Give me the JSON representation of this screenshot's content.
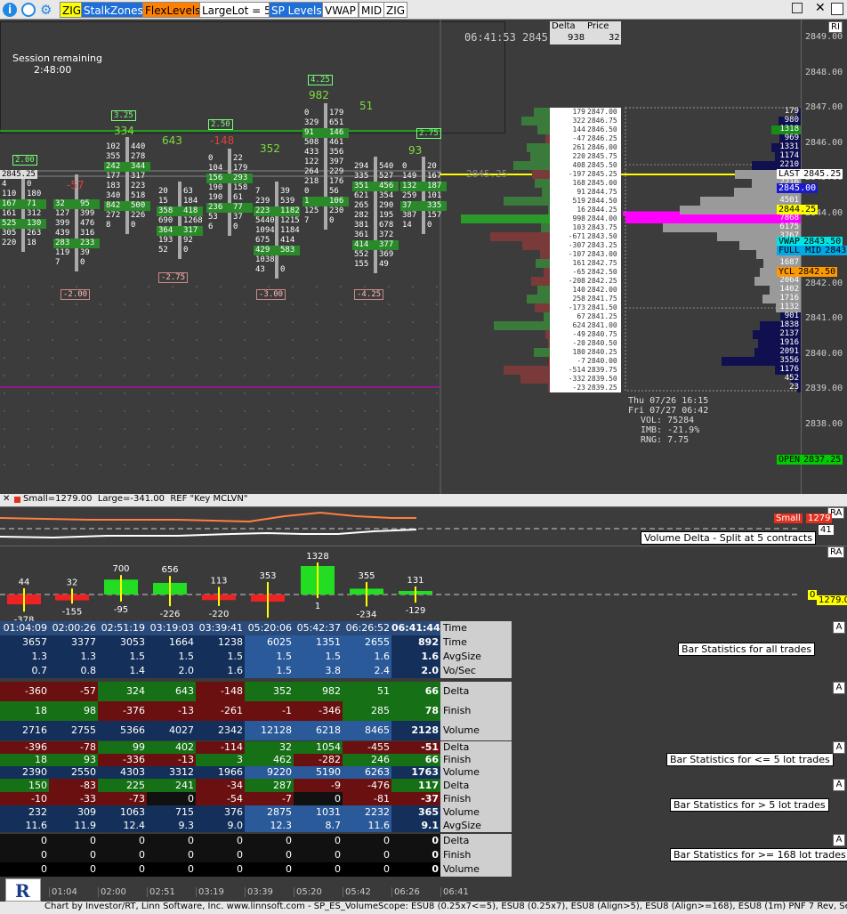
{
  "toolbar": {
    "buttons": [
      {
        "label": "ZIG",
        "bg": "#ffff00",
        "fg": "#000000"
      },
      {
        "label": "StalkZones",
        "bg": "#1e6fd9",
        "fg": "#ffffff"
      },
      {
        "label": "FlexLevels",
        "bg": "#ff7f00",
        "fg": "#000000"
      },
      {
        "label": "LargeLot = 5",
        "bg": "#ffffff",
        "fg": "#000000"
      },
      {
        "label": "SP Levels",
        "bg": "#1e6fd9",
        "fg": "#ffffff"
      },
      {
        "label": "VWAP",
        "bg": "#ffffff",
        "fg": "#000000"
      },
      {
        "label": "MID",
        "bg": "#ffffff",
        "fg": "#000000"
      },
      {
        "label": "ZIG",
        "bg": "#ffffff",
        "fg": "#000000"
      }
    ],
    "right_ri": "RI"
  },
  "session": {
    "label": "Session remaining",
    "time": "2:48:00"
  },
  "clock": {
    "time": "06:41:53",
    "price": "2845.25",
    "delta_header": "Delta",
    "price_header": "Price",
    "delta_value": "938",
    "price_value": "32"
  },
  "price_axis": {
    "ticks": [
      "2849.00",
      "2848.00",
      "2847.00",
      "2846.00",
      "2845.00",
      "2844.00",
      "2843.00",
      "2842.00",
      "2841.00",
      "2840.00",
      "2839.00",
      "2838.00",
      "2837.00"
    ],
    "labels": [
      {
        "text": "LAST",
        "value": "2845.25",
        "bg": "#ffffff",
        "fg": "#000000"
      },
      {
        "text": "",
        "value": "2845.00",
        "bg": "#1a1acc",
        "fg": "#ffffff"
      },
      {
        "text": "",
        "value": "2844.25",
        "bg": "#ffff00",
        "fg": "#000000"
      },
      {
        "text": "VWAP",
        "value": "2843.50",
        "bg": "#00e5e5",
        "fg": "#000000"
      },
      {
        "text": "FULL MID",
        "value": "2843.25",
        "bg": "#00a8e5",
        "fg": "#000000"
      },
      {
        "text": "YCL",
        "value": "2842.50",
        "bg": "#ff9900",
        "fg": "#000000"
      },
      {
        "text": "OPEN",
        "value": "2837.25",
        "bg": "#00cc00",
        "fg": "#000000"
      }
    ]
  },
  "ladder": {
    "rows": [
      {
        "d": "179",
        "p": "2847.00",
        "vol": "179"
      },
      {
        "d": "322",
        "p": "2846.75",
        "vol": "980"
      },
      {
        "d": "144",
        "p": "2846.50",
        "vol": "1318"
      },
      {
        "d": "-47",
        "p": "2846.25",
        "vol": "969"
      },
      {
        "d": "261",
        "p": "2846.00",
        "vol": "1331"
      },
      {
        "d": "220",
        "p": "2845.75",
        "vol": "1174"
      },
      {
        "d": "408",
        "p": "2845.50",
        "vol": "2210"
      },
      {
        "d": "-197",
        "p": "2845.25",
        "vol": "2975"
      },
      {
        "d": "168",
        "p": "2845.00",
        "vol": "2216"
      },
      {
        "d": "91",
        "p": "2844.75",
        "vol": "3003"
      },
      {
        "d": "519",
        "p": "2844.50",
        "vol": "4501"
      },
      {
        "d": "16",
        "p": "2844.25",
        "vol": "5440"
      },
      {
        "d": "998",
        "p": "2844.00",
        "vol": "7868"
      },
      {
        "d": "103",
        "p": "2843.75",
        "vol": "6175"
      },
      {
        "d": "-671",
        "p": "2843.50",
        "vol": "3767"
      },
      {
        "d": "-307",
        "p": "2843.25",
        "vol": "2765"
      },
      {
        "d": "-107",
        "p": "2843.00",
        "vol": "2001"
      },
      {
        "d": "161",
        "p": "2842.75",
        "vol": "1687"
      },
      {
        "d": "-65",
        "p": "2842.50",
        "vol": "1851"
      },
      {
        "d": "-208",
        "p": "2842.25",
        "vol": "2064"
      },
      {
        "d": "140",
        "p": "2842.00",
        "vol": "1402"
      },
      {
        "d": "258",
        "p": "2841.75",
        "vol": "1716"
      },
      {
        "d": "-173",
        "p": "2841.50",
        "vol": "1132"
      },
      {
        "d": "67",
        "p": "2841.25",
        "vol": "901"
      },
      {
        "d": "624",
        "p": "2841.00",
        "vol": "1838"
      },
      {
        "d": "-49",
        "p": "2840.75",
        "vol": "2137"
      },
      {
        "d": "-20",
        "p": "2840.50",
        "vol": "1916"
      },
      {
        "d": "180",
        "p": "2840.25",
        "vol": "2091"
      },
      {
        "d": "-7",
        "p": "2840.00",
        "vol": "3556"
      },
      {
        "d": "-514",
        "p": "2839.75",
        "vol": "1176"
      },
      {
        "d": "-332",
        "p": "2839.50",
        "vol": "452"
      },
      {
        "d": "-23",
        "p": "2839.25",
        "vol": "23"
      }
    ]
  },
  "session_info": {
    "line1": "Thu 07/26 16:15",
    "line2": "Fri 07/27 06:42",
    "vol": "VOL: 75284",
    "imb": "IMB: -21.9%",
    "rng": "RNG: 7.75"
  },
  "chart_labels": {
    "left_price": "2845.25",
    "marker_price": "2845.25",
    "zig_top": [
      "4.25",
      "3.25",
      "2.50",
      "2.75",
      "2.00"
    ],
    "zig_bottom": [
      "-2.00",
      "-2.75",
      "-3.00",
      "-4.25"
    ],
    "bar_deltas": [
      "-57",
      "334",
      "643",
      "-148",
      "352",
      "982",
      "51",
      "93"
    ]
  },
  "delta_panel": {
    "legend": "Small=1279.00  Large=-341.00  REF \"Key MCLVN\"",
    "small_label": "Small",
    "small_value": "1279",
    "large_label": "Large",
    "large_value": "-341",
    "right_value": "41",
    "title": "Volume Delta - Split at 5 contracts",
    "ra": "RA"
  },
  "hist_panel": {
    "ra": "RA",
    "right_a": "0",
    "right_b": "1279.00",
    "bars": [
      {
        "top": "44",
        "bottom": "-378"
      },
      {
        "top": "32",
        "bottom": "-155"
      },
      {
        "top": "700",
        "bottom": "-95"
      },
      {
        "top": "656",
        "bottom": "-226"
      },
      {
        "top": "113",
        "bottom": "-220"
      },
      {
        "top": "353",
        "bottom": "-545"
      },
      {
        "top": "1328",
        "bottom": "1"
      },
      {
        "top": "355",
        "bottom": "-234"
      },
      {
        "top": "131",
        "bottom": "-129"
      }
    ]
  },
  "stats": {
    "times": [
      "01:04:09",
      "02:00:26",
      "02:51:19",
      "03:19:03",
      "03:39:41",
      "05:20:06",
      "05:42:37",
      "06:26:52",
      "06:41:44"
    ],
    "g1": {
      "desc": "Bar Statistics for all trades",
      "rows": [
        {
          "label": "Time",
          "vals": [
            "01:04:09",
            "02:00:26",
            "02:51:19",
            "03:19:03",
            "03:39:41",
            "05:20:06",
            "05:42:37",
            "06:26:52",
            "06:41:44"
          ]
        },
        {
          "label": "Time",
          "vals": [
            "3657",
            "3377",
            "3053",
            "1664",
            "1238",
            "6025",
            "1351",
            "2655",
            "892"
          ]
        },
        {
          "label": "AvgSize",
          "vals": [
            "1.3",
            "1.3",
            "1.5",
            "1.5",
            "1.5",
            "1.5",
            "1.5",
            "1.6",
            "1.6"
          ]
        },
        {
          "label": "Vo/Sec",
          "vals": [
            "0.7",
            "0.8",
            "1.4",
            "2.0",
            "1.6",
            "1.5",
            "3.8",
            "2.4",
            "2.0"
          ]
        }
      ]
    },
    "g2": {
      "rows": [
        {
          "label": "Delta",
          "vals": [
            "-360",
            "-57",
            "324",
            "643",
            "-148",
            "352",
            "982",
            "51",
            "66"
          ]
        },
        {
          "label": "Finish",
          "vals": [
            "18",
            "98",
            "-376",
            "-13",
            "-261",
            "-1",
            "-346",
            "285",
            "78"
          ]
        },
        {
          "label": "Volume",
          "vals": [
            "2716",
            "2755",
            "5366",
            "4027",
            "2342",
            "12128",
            "6218",
            "8465",
            "2128"
          ]
        }
      ]
    },
    "g3": {
      "desc": "Bar Statistics for <= 5 lot trades",
      "rows": [
        {
          "label": "Delta",
          "vals": [
            "-396",
            "-78",
            "99",
            "402",
            "-114",
            "32",
            "1054",
            "-455",
            "-51"
          ]
        },
        {
          "label": "Finish",
          "vals": [
            "18",
            "93",
            "-336",
            "-13",
            "3",
            "462",
            "-282",
            "246",
            "66"
          ]
        },
        {
          "label": "Volume",
          "vals": [
            "2390",
            "2550",
            "4303",
            "3312",
            "1966",
            "9220",
            "5190",
            "6263",
            "1763"
          ]
        }
      ]
    },
    "g4": {
      "desc": "Bar Statistics for > 5 lot trades",
      "rows": [
        {
          "label": "Delta",
          "vals": [
            "150",
            "-83",
            "225",
            "241",
            "-34",
            "287",
            "-9",
            "-476",
            "117"
          ]
        },
        {
          "label": "Finish",
          "vals": [
            "-10",
            "-33",
            "-73",
            "0",
            "-54",
            "-7",
            "0",
            "-81",
            "-37"
          ]
        },
        {
          "label": "Volume",
          "vals": [
            "232",
            "309",
            "1063",
            "715",
            "376",
            "2875",
            "1031",
            "2232",
            "365"
          ]
        },
        {
          "label": "AvgSize",
          "vals": [
            "11.6",
            "11.9",
            "12.4",
            "9.3",
            "9.0",
            "12.3",
            "8.7",
            "11.6",
            "9.1"
          ]
        }
      ]
    },
    "g5": {
      "desc": "Bar Statistics for >= 168 lot trades",
      "rows": [
        {
          "label": "Delta",
          "vals": [
            "0",
            "0",
            "0",
            "0",
            "0",
            "0",
            "0",
            "0",
            "0"
          ]
        },
        {
          "label": "Finish",
          "vals": [
            "0",
            "0",
            "0",
            "0",
            "0",
            "0",
            "0",
            "0",
            "0"
          ]
        },
        {
          "label": "Volume",
          "vals": [
            "0",
            "0",
            "0",
            "0",
            "0",
            "0",
            "0",
            "0",
            "0"
          ]
        }
      ]
    },
    "a_label": "A"
  },
  "time_axis": [
    "01:04",
    "02:00",
    "02:51",
    "03:19",
    "03:39",
    "05:20",
    "05:42",
    "06:26",
    "06:41"
  ],
  "footer": "Chart by Investor/RT, Linn Software, Inc. www.linnsoft.com - SP_ES_VolumeScope: ESU8 (0.25x7<=5), ESU8 (0.25x7), ESU8 (Align>5), ESU8 (Align>=168), ESU8 (1m) PNF 7 Rev, Sessio"
}
